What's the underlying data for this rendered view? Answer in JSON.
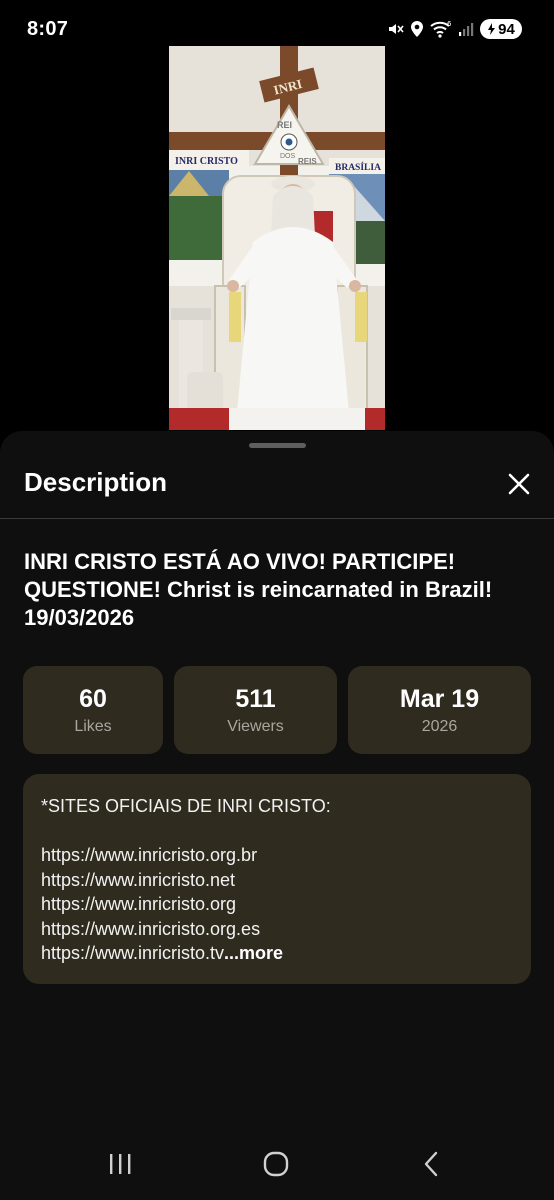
{
  "status_bar": {
    "time": "8:07",
    "battery": "94",
    "icons": [
      "mute-icon",
      "location-icon",
      "wifi-icon",
      "signal-icon",
      "battery-icon"
    ]
  },
  "sheet": {
    "title": "Description",
    "close_icon": "close-icon"
  },
  "video_title": "INRI CRISTO ESTÁ AO VIVO! PARTICIPE! QUESTIONE! Christ is reincarnated in Brazil! 19/03/2026",
  "stats": [
    {
      "value": "60",
      "label": "Likes"
    },
    {
      "value": "511",
      "label": "Viewers"
    },
    {
      "value": "Mar 19",
      "label": "2026"
    }
  ],
  "description": {
    "lines": [
      "*SITES OFICIAIS DE INRI CRISTO:",
      "https://www.inricristo.org.br",
      "https://www.inricristo.net",
      "https://www.inricristo.org",
      "https://www.inricristo.org.es",
      "https://www.inricristo.tv"
    ],
    "more_label": "...more"
  },
  "video_thumb": {
    "sign_top": "INRI",
    "sign_left": "INRI CRISTO",
    "sign_right": "BRASÍLIA",
    "emblem_words": [
      "REI",
      "DOS",
      "REIS"
    ]
  },
  "nav": {
    "icons": [
      "recent-apps-icon",
      "home-icon",
      "back-icon"
    ]
  },
  "colors": {
    "sheet_bg": "#0f0f0f",
    "card_bg": "#2f2b1e",
    "label_gray": "#a9a6a0"
  }
}
